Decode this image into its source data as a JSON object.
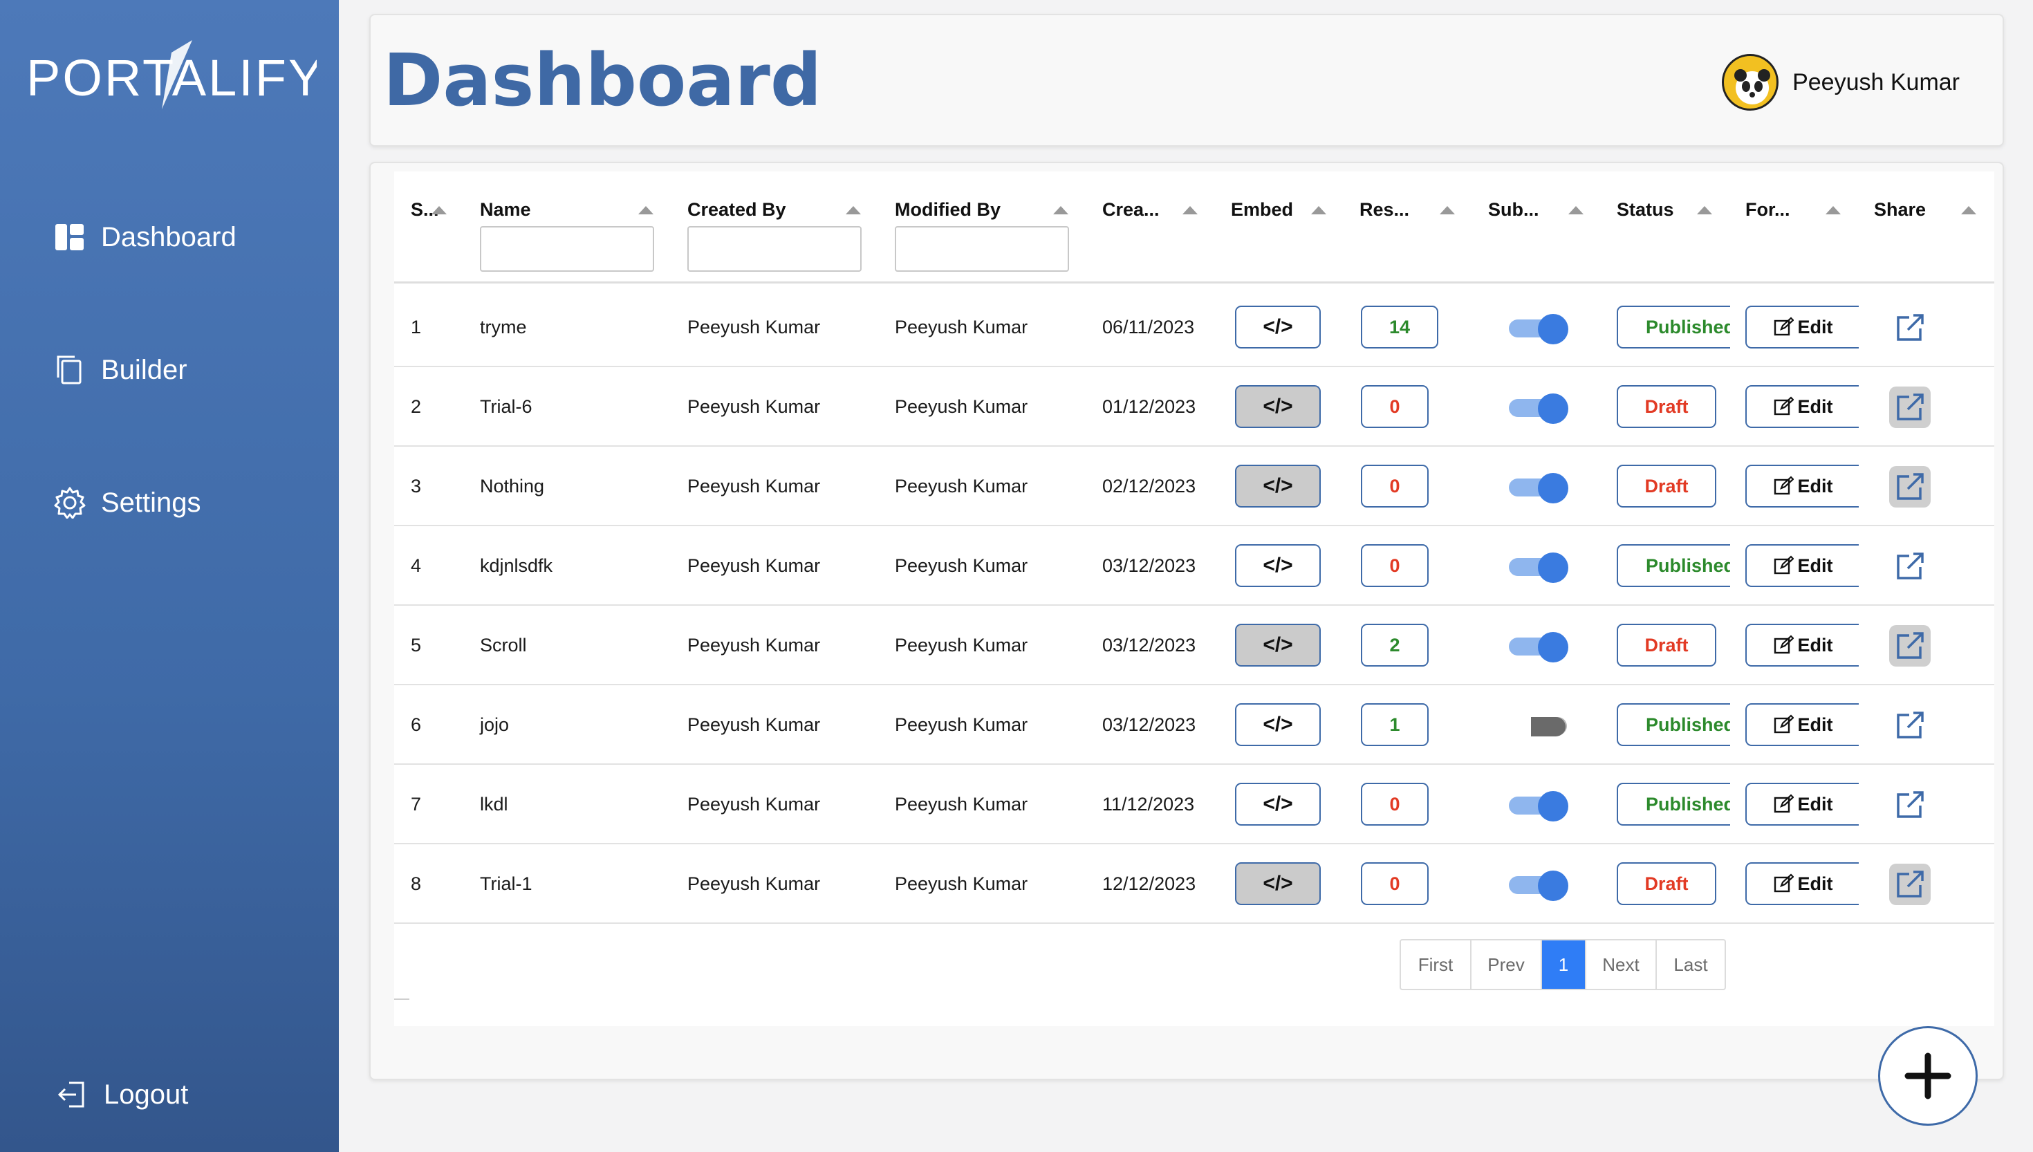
{
  "sidebar": {
    "logo": "PORTALIFY",
    "items": [
      {
        "label": "Dashboard",
        "icon": "dashboard-icon"
      },
      {
        "label": "Builder",
        "icon": "copy-icon"
      },
      {
        "label": "Settings",
        "icon": "gear-icon"
      }
    ],
    "logout": "Logout"
  },
  "header": {
    "title": "Dashboard",
    "user_name": "Peeyush Kumar"
  },
  "table": {
    "columns": [
      "S...",
      "Name",
      "Created By",
      "Modified By",
      "Crea...",
      "Embed",
      "Res...",
      "Sub...",
      "Status",
      "For...",
      "Share"
    ],
    "rows": [
      {
        "sno": "1",
        "name": "tryme",
        "created_by": "Peeyush Kumar",
        "modified_by": "Peeyush Kumar",
        "created": "06/11/2023",
        "embed": "</>",
        "responses": "14",
        "status": "Published",
        "form": "Edit"
      },
      {
        "sno": "2",
        "name": "Trial-6",
        "created_by": "Peeyush Kumar",
        "modified_by": "Peeyush Kumar",
        "created": "01/12/2023",
        "embed": "</>",
        "responses": "0",
        "status": "Draft",
        "form": "Edit"
      },
      {
        "sno": "3",
        "name": "Nothing",
        "created_by": "Peeyush Kumar",
        "modified_by": "Peeyush Kumar",
        "created": "02/12/2023",
        "embed": "</>",
        "responses": "0",
        "status": "Draft",
        "form": "Edit"
      },
      {
        "sno": "4",
        "name": "kdjnlsdfk",
        "created_by": "Peeyush Kumar",
        "modified_by": "Peeyush Kumar",
        "created": "03/12/2023",
        "embed": "</>",
        "responses": "0",
        "status": "Published",
        "form": "Edit"
      },
      {
        "sno": "5",
        "name": "Scroll",
        "created_by": "Peeyush Kumar",
        "modified_by": "Peeyush Kumar",
        "created": "03/12/2023",
        "embed": "</>",
        "responses": "2",
        "status": "Draft",
        "form": "Edit"
      },
      {
        "sno": "6",
        "name": "jojo",
        "created_by": "Peeyush Kumar",
        "modified_by": "Peeyush Kumar",
        "created": "03/12/2023",
        "embed": "</>",
        "responses": "1",
        "status": "Published",
        "form": "Edit"
      },
      {
        "sno": "7",
        "name": "lkdl",
        "created_by": "Peeyush Kumar",
        "modified_by": "Peeyush Kumar",
        "created": "11/12/2023",
        "embed": "</>",
        "responses": "0",
        "status": "Published",
        "form": "Edit"
      },
      {
        "sno": "8",
        "name": "Trial-1",
        "created_by": "Peeyush Kumar",
        "modified_by": "Peeyush Kumar",
        "created": "12/12/2023",
        "embed": "</>",
        "responses": "0",
        "status": "Draft",
        "form": "Edit"
      }
    ]
  },
  "pagination": {
    "first": "First",
    "prev": "Prev",
    "current": "1",
    "next": "Next",
    "last": "Last"
  },
  "colors": {
    "sidebar_bg": "#4672b0",
    "title": "#3f69a5",
    "published": "#2c8a2c",
    "draft": "#e23a24",
    "toggle_on": "#3a7be0",
    "page_active": "#2f7df6"
  },
  "fab_icon": "plus-icon"
}
